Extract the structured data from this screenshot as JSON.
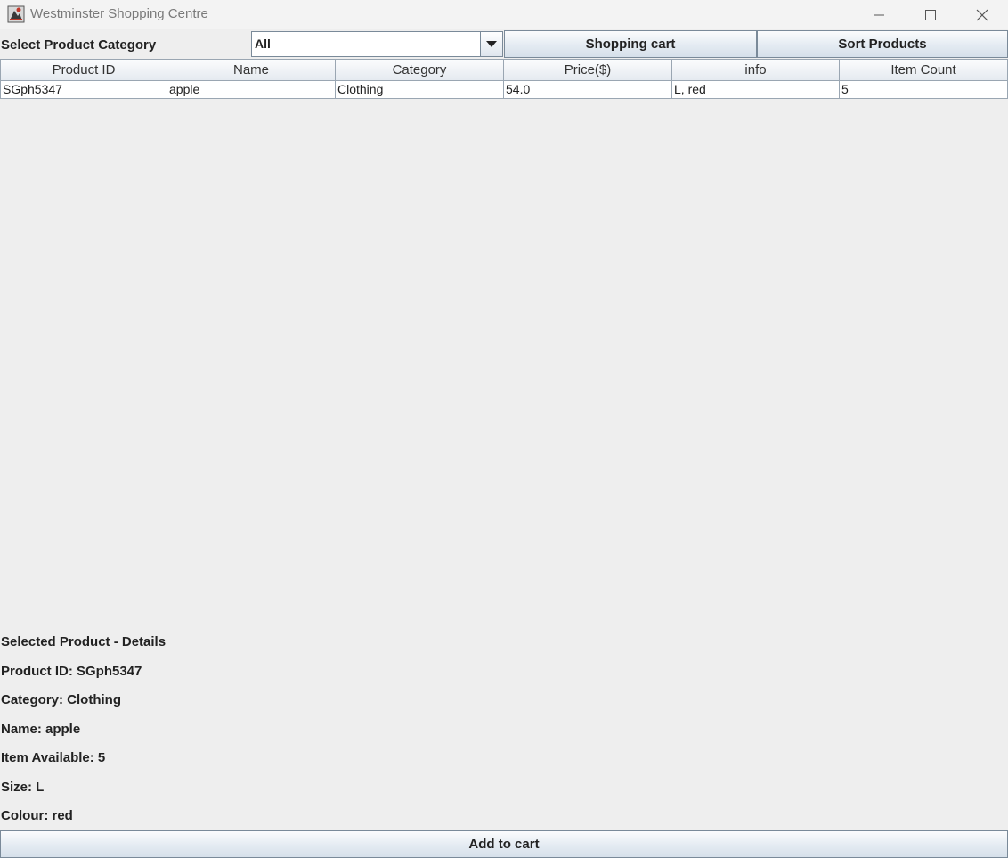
{
  "window": {
    "title": "Westminster Shopping Centre",
    "icons": [
      "app-icon",
      "minimize-icon",
      "maximize-icon",
      "close-icon"
    ]
  },
  "toolbar": {
    "category_label": "Select Product Category",
    "category_selected": "All",
    "shopping_cart_label": "Shopping cart",
    "sort_products_label": "Sort Products"
  },
  "table": {
    "columns": [
      "Product ID",
      "Name",
      "Category",
      "Price($)",
      "info",
      "Item Count"
    ],
    "rows": [
      [
        "SGph5347",
        "apple",
        "Clothing",
        "54.0",
        "L, red",
        "5"
      ]
    ]
  },
  "details": {
    "heading": "Selected Product - Details",
    "product_id": "Product ID: SGph5347",
    "category": "Category: Clothing",
    "name": "Name: apple",
    "items_available": "Item Available: 5",
    "size": "Size: L",
    "colour": "Colour: red"
  },
  "actions": {
    "add_to_cart_label": "Add to cart"
  },
  "colors": {
    "background": "#eeeeee",
    "button_border": "#7a8a99",
    "grid_line": "#9aa6b2"
  }
}
